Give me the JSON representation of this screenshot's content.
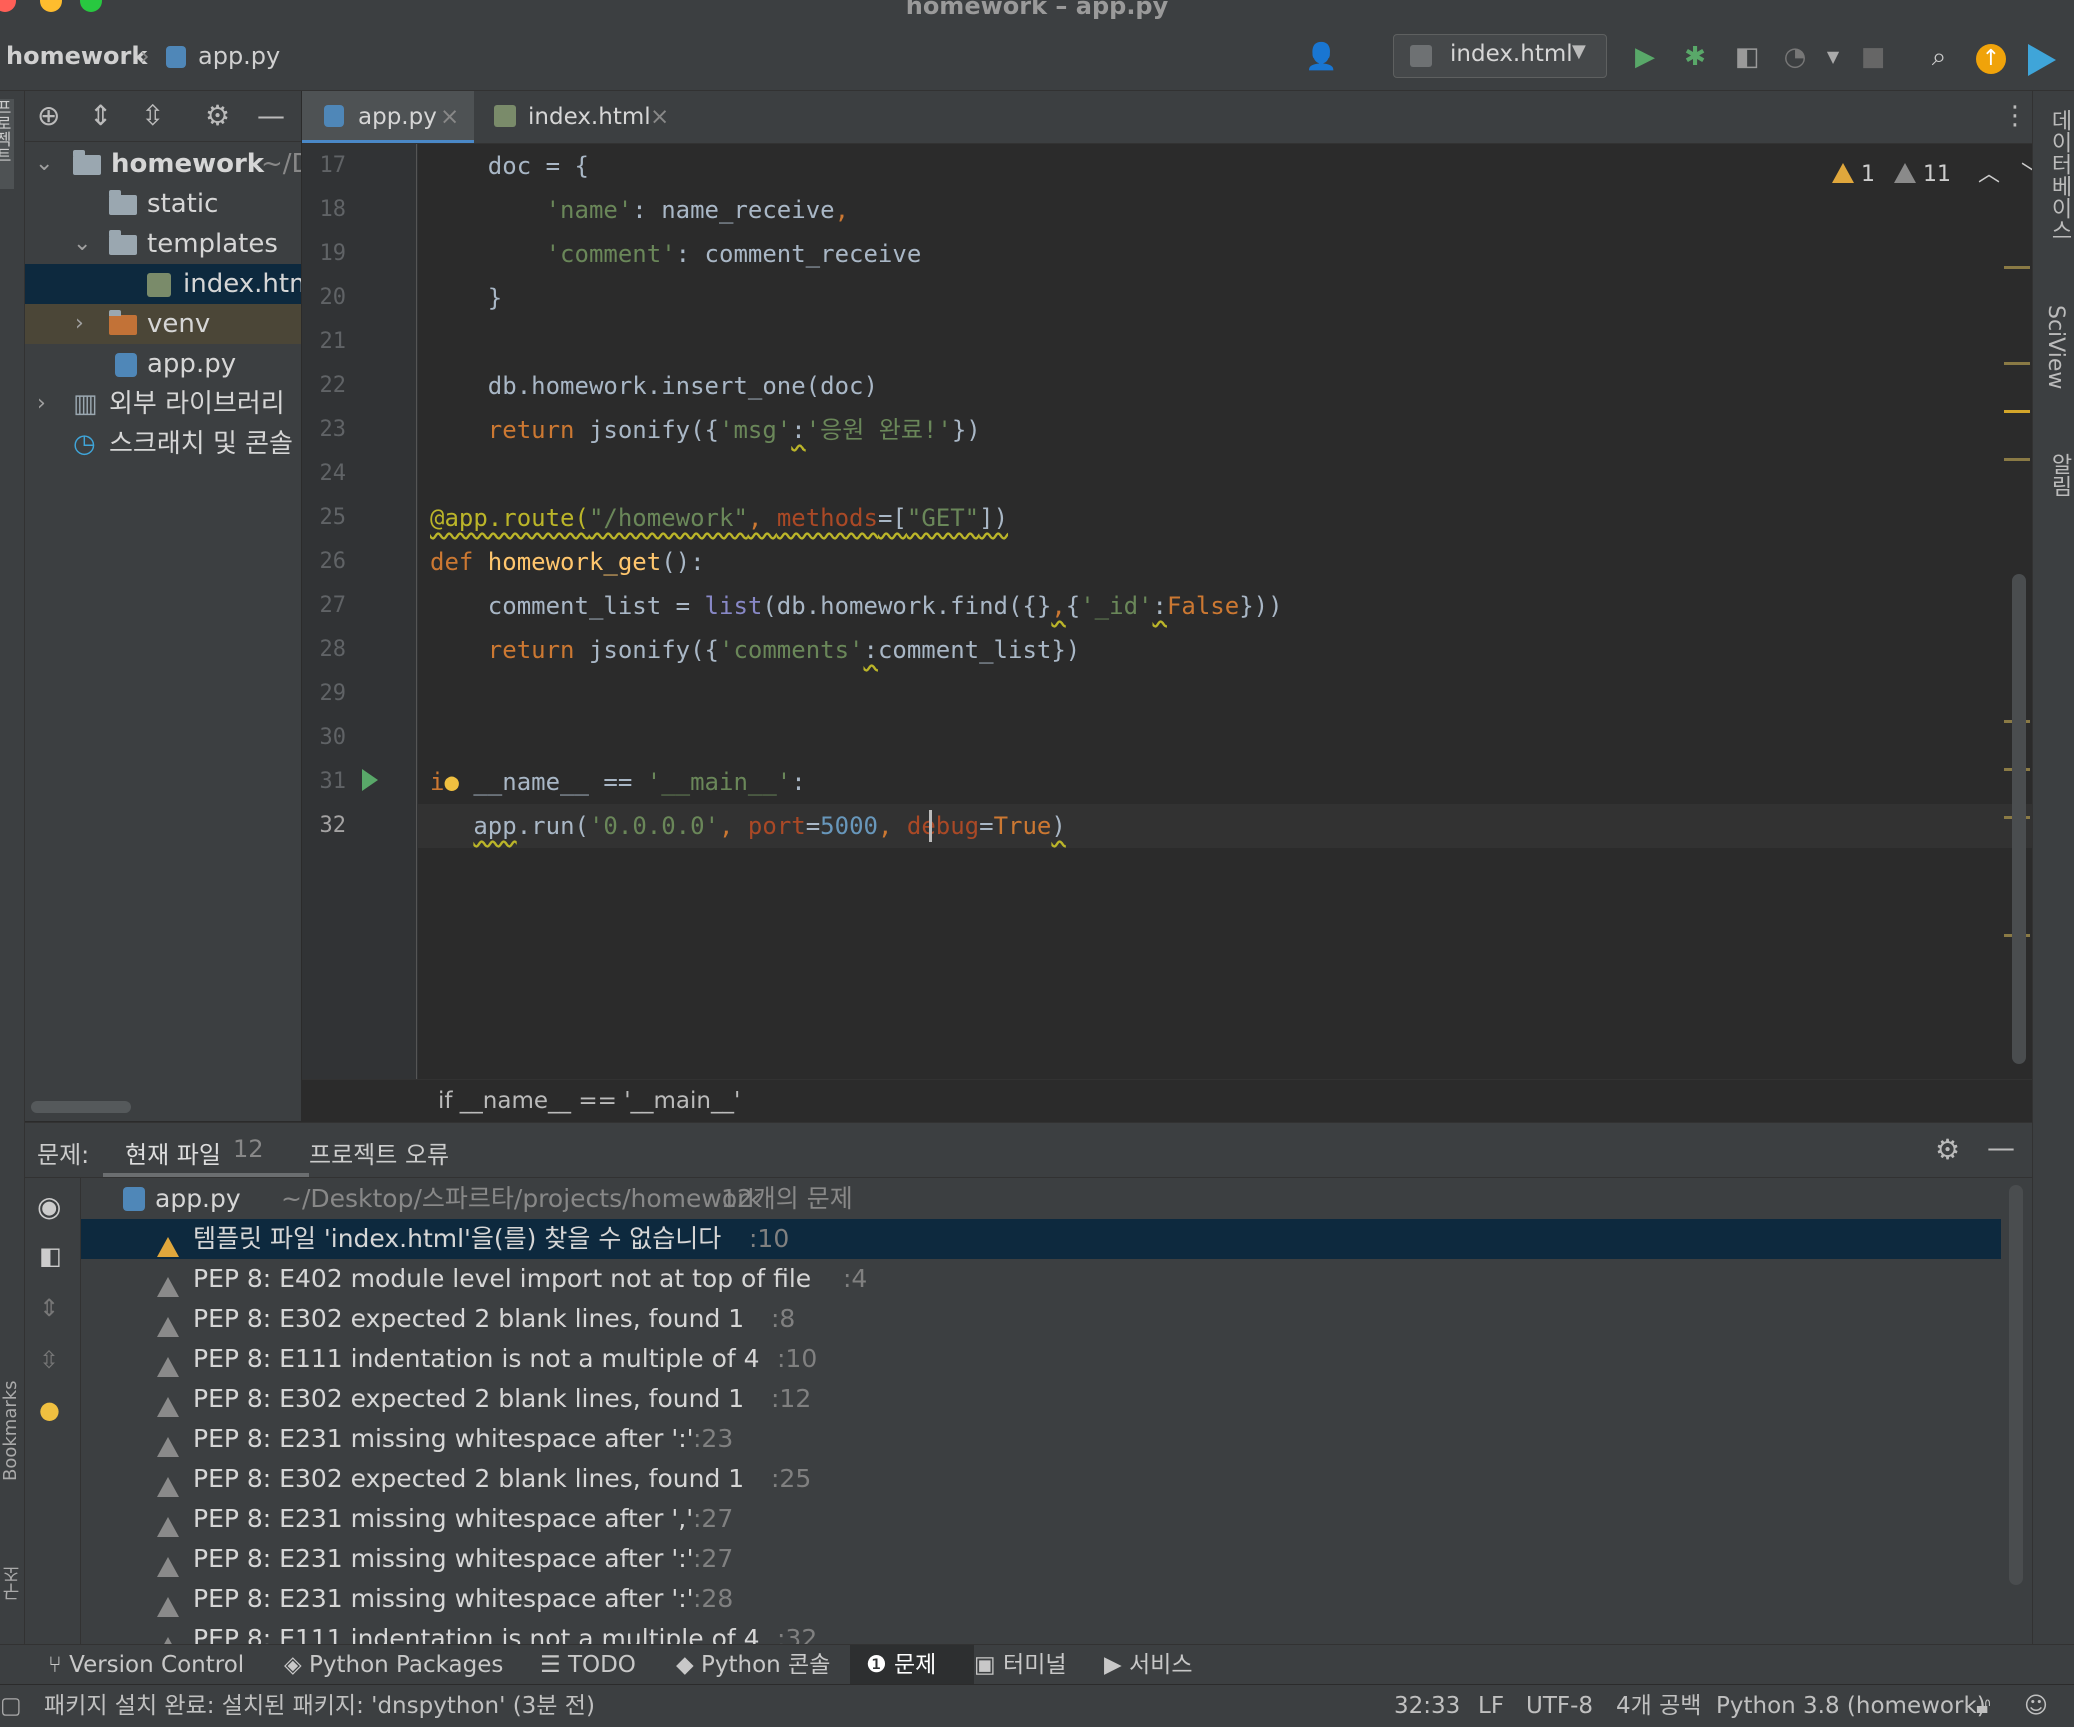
{
  "window": {
    "title": "homework – app.py"
  },
  "navbar": {
    "project": "homework",
    "file": "app.py",
    "run_config": "index.html"
  },
  "editor_tabs": [
    {
      "label": "app.py",
      "active": true
    },
    {
      "label": "index.html",
      "active": false
    }
  ],
  "project_tree": {
    "root": {
      "label": "homework",
      "path": "~/D"
    },
    "items": [
      "static",
      "templates",
      "index.htm",
      "venv",
      "app.py",
      "외부 라이브러리",
      "스크래치 및 콘솔"
    ]
  },
  "inspections": {
    "warn1": "1",
    "warn2": "11"
  },
  "code_lines": [
    {
      "n": "17"
    },
    {
      "n": "18"
    },
    {
      "n": "19"
    },
    {
      "n": "20"
    },
    {
      "n": "21"
    },
    {
      "n": "22"
    },
    {
      "n": "23"
    },
    {
      "n": "24"
    },
    {
      "n": "25"
    },
    {
      "n": "26"
    },
    {
      "n": "27"
    },
    {
      "n": "28"
    },
    {
      "n": "29"
    },
    {
      "n": "30"
    },
    {
      "n": "31"
    },
    {
      "n": "32"
    }
  ],
  "code": {
    "l17a": "    doc = {",
    "l18_key": "'name'",
    "l18_rest": ": name_receive",
    "l19_key": "'comment'",
    "l19_rest": ": comment_receive",
    "l20": "    }",
    "l22": "    db.homework.insert_one(doc)",
    "l23_ret": "return",
    "l23_call": " jsonify({",
    "l23_s1": "'msg'",
    "l23_colon": ":",
    "l23_s2": "'응원 완료!'",
    "l23_end": "})",
    "l25_dec": "@app.route(",
    "l25_s": "\"/homework\"",
    "l25_comma": ", ",
    "l25_param": "methods",
    "l25_eq": "=[",
    "l25_s2": "\"GET\"",
    "l25_end": "])",
    "l26_def": "def",
    "l26_fn": " homework_get",
    "l26_end": "():",
    "l27_a": "    comment_list = ",
    "l27_list": "list",
    "l27_b": "(db.homework.find({}",
    "l27_comma": ",",
    "l27_c": "{",
    "l27_s": "'_id'",
    "l27_colon": ":",
    "l27_false": "False",
    "l27_end": "}))",
    "l28_ret": "return",
    "l28_call": " jsonify({",
    "l28_s": "'comments'",
    "l28_colon": ":",
    "l28_end": "comment_list})",
    "l31_if": "i",
    "l31_rest": " __name__ == ",
    "l31_s": "'__main__'",
    "l31_end": ":",
    "l32_app": "app",
    "l32_run": ".run(",
    "l32_s": "'0.0.0.0'",
    "l32_c1": ", ",
    "l32_port": "port",
    "l32_eq": "=",
    "l32_num": "5000",
    "l32_c2": ", ",
    "l32_debug": "debug",
    "l32_eq2": "=",
    "l32_true": "True",
    "l32_end": ")"
  },
  "breadcrumb": "if __name__ == '__main__'",
  "problems": {
    "label": "문제:",
    "tab_current": "현재 파일",
    "tab_current_count": "12",
    "tab_project": "프로젝트 오류",
    "file": "app.py",
    "file_path": "~/Desktop/스파르타/projects/homework",
    "file_count": "12개의 문제",
    "items": [
      {
        "text": "템플릿 파일 'index.html'을(를) 찾을 수 없습니다",
        "line": ":10"
      },
      {
        "text": "PEP 8: E402 module level import not at top of file",
        "line": ":4"
      },
      {
        "text": "PEP 8: E302 expected 2 blank lines, found 1",
        "line": ":8"
      },
      {
        "text": "PEP 8: E111 indentation is not a multiple of 4",
        "line": ":10"
      },
      {
        "text": "PEP 8: E302 expected 2 blank lines, found 1",
        "line": ":12"
      },
      {
        "text": "PEP 8: E231 missing whitespace after ':'",
        "line": ":23"
      },
      {
        "text": "PEP 8: E302 expected 2 blank lines, found 1",
        "line": ":25"
      },
      {
        "text": "PEP 8: E231 missing whitespace after ','",
        "line": ":27"
      },
      {
        "text": "PEP 8: E231 missing whitespace after ':'",
        "line": ":27"
      },
      {
        "text": "PEP 8: E231 missing whitespace after ':'",
        "line": ":28"
      },
      {
        "text": "PEP 8: E111 indentation is not a multiple of 4",
        "line": ":32"
      }
    ]
  },
  "toolwindows": [
    "Version Control",
    "Python Packages",
    "TODO",
    "Python 콘솔",
    "문제",
    "터미널",
    "서비스"
  ],
  "right_strip": [
    "데이터베이스",
    "SciView",
    "알림"
  ],
  "left_strip": [
    "프로젝트",
    "Bookmarks",
    "구조"
  ],
  "status": {
    "message": "패키지 설치 완료: 설치된 패키지: 'dnspython' (3분 전)",
    "position": "32:33",
    "line_sep": "LF",
    "encoding": "UTF-8",
    "indent": "4개 공백",
    "interpreter": "Python 3.8 (homework)"
  },
  "colors": {
    "accent": "#4a88c7",
    "warning": "#e0a73c",
    "selection": "#0d293e"
  }
}
